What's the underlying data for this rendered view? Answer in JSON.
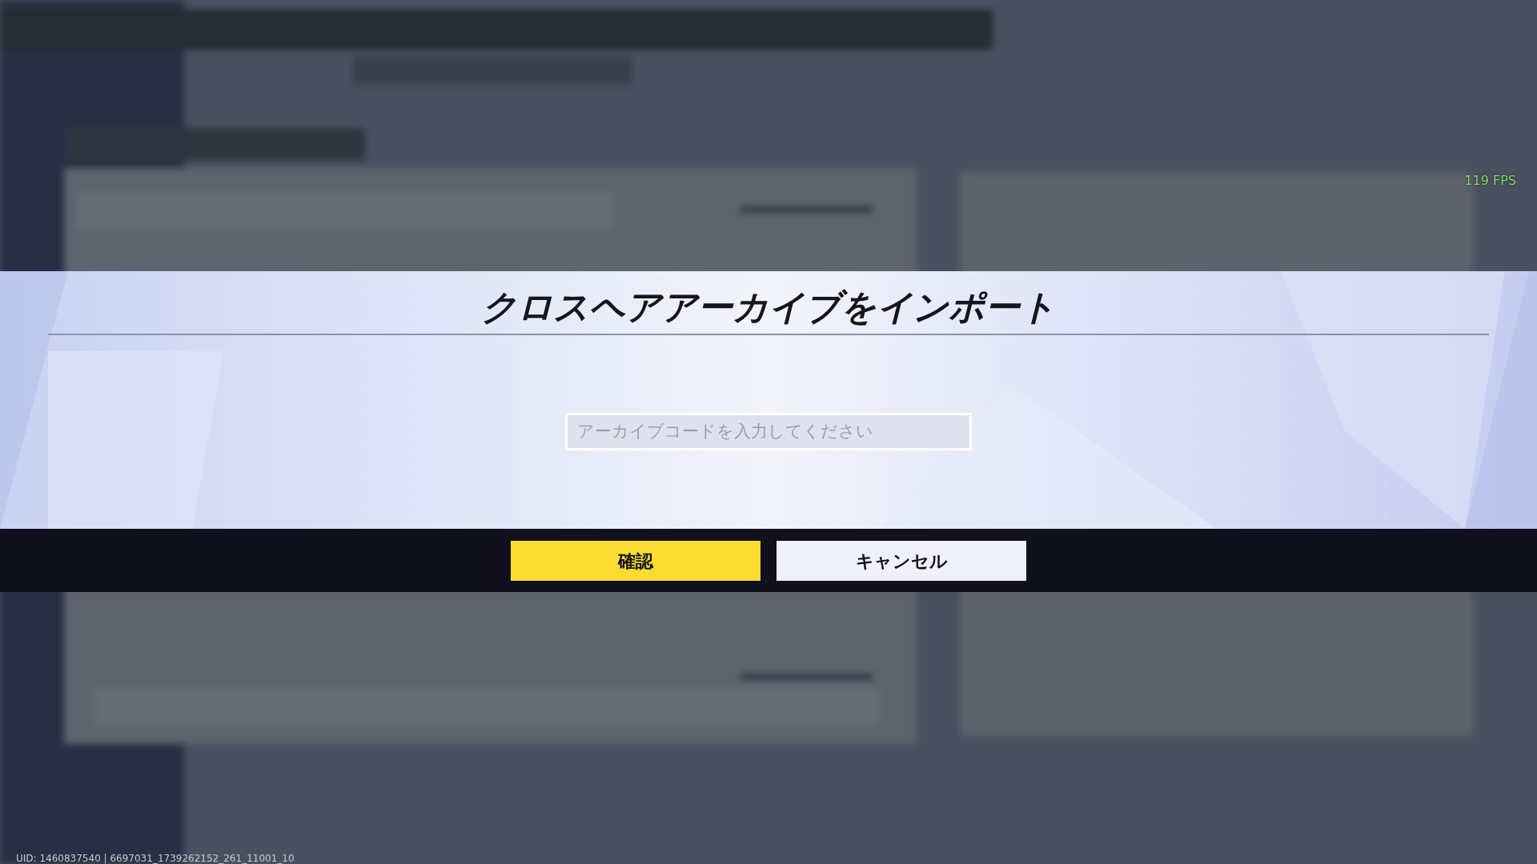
{
  "overlay": {
    "fps": "119 FPS",
    "uid": "UID: 1460837540 | 6697031_1739262152_261_11001_10"
  },
  "dialog": {
    "title": "クロスヘアアーカイブをインポート",
    "code_field": {
      "placeholder": "アーカイブコードを入力してください"
    },
    "buttons": [
      {
        "kind": "primary",
        "label": "確認"
      },
      {
        "kind": "secondary",
        "label": "キャンセル"
      }
    ]
  }
}
